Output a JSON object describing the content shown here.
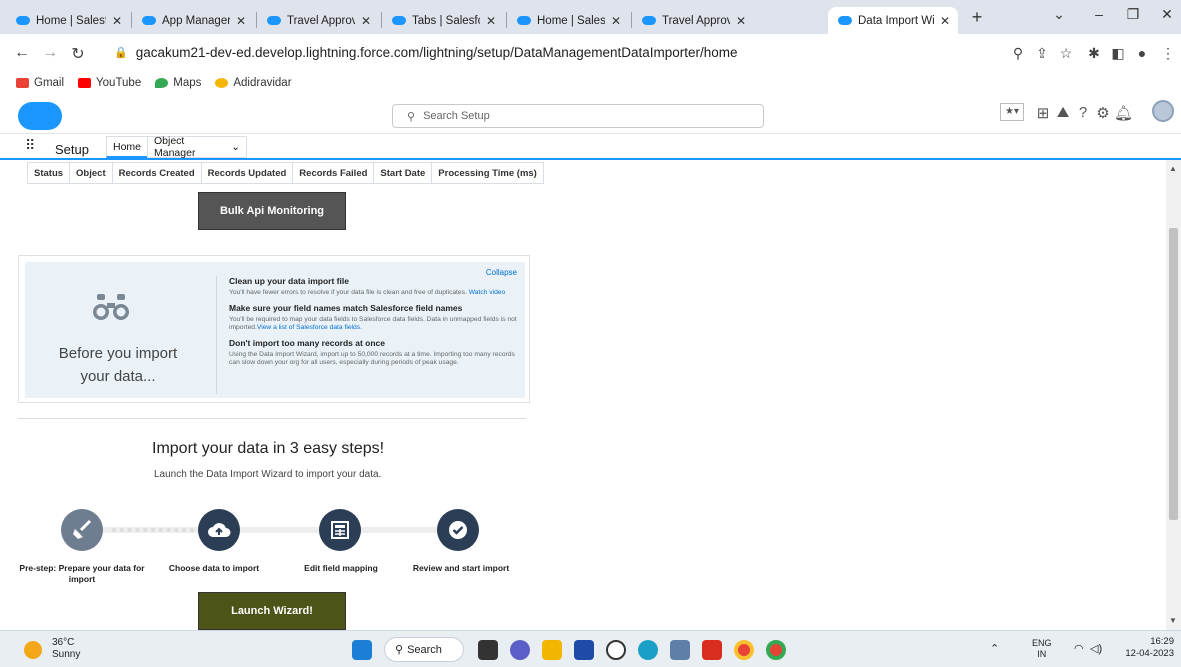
{
  "browser": {
    "tabs": [
      {
        "label": "Home | Salesforce",
        "active": false
      },
      {
        "label": "App Manager | Sa",
        "active": false
      },
      {
        "label": "Travel Approval |",
        "active": false
      },
      {
        "label": "Tabs | Salesforce",
        "active": false
      },
      {
        "label": "Home | Salesforce",
        "active": false
      },
      {
        "label": "Travel Approval |",
        "active": false
      },
      {
        "label": "Data Import Wiza",
        "active": true
      }
    ],
    "url": "gacakum21-dev-ed.develop.lightning.force.com/lightning/setup/DataManagementDataImporter/home",
    "bookmarks": [
      "Gmail",
      "YouTube",
      "Maps",
      "Adidravidar"
    ]
  },
  "sf_header": {
    "search_placeholder": "Search Setup"
  },
  "sf_nav": {
    "app_title": "Setup",
    "tabs": [
      "Home",
      "Object Manager"
    ]
  },
  "status_table": {
    "columns": [
      "Status",
      "Object",
      "Records Created",
      "Records Updated",
      "Records Failed",
      "Start Date",
      "Processing Time (ms)"
    ]
  },
  "bulk_button": "Bulk Api Monitoring",
  "tips_panel": {
    "collapse_label": "Collapse",
    "heading_line1": "Before you import",
    "heading_line2": "your data...",
    "tips": [
      {
        "title": "Clean up your data import file",
        "text": "You'll have fewer errors to resolve if your data file is clean and free of duplicates.",
        "link": "Watch video"
      },
      {
        "title": "Make sure your field names match Salesforce field names",
        "text": "You'll be required to map your data fields to Salesforce data fields. Data in unmapped fields is not imported.",
        "link": "View a list of Salesforce data fields."
      },
      {
        "title": "Don't import too many records at once",
        "text": "Using the Data Import Wizard, import up to 50,000 records at a time. Importing too many records can slow down your org for all users, especially during periods of peak usage.",
        "link": ""
      }
    ]
  },
  "steps": {
    "title": "Import your data in 3 easy steps!",
    "subtitle": "Launch the Data Import Wizard to import your data.",
    "items": [
      {
        "label": "Pre-step: Prepare your data for import",
        "icon": "broom-icon"
      },
      {
        "label": "Choose data to import",
        "icon": "cloud-upload-icon"
      },
      {
        "label": "Edit field mapping",
        "icon": "table-icon"
      },
      {
        "label": "Review and start import",
        "icon": "check-icon"
      }
    ],
    "launch_button": "Launch Wizard!"
  },
  "taskbar": {
    "weather_temp": "36°C",
    "weather_desc": "Sunny",
    "search_label": "Search",
    "lang": "ENG",
    "region": "IN",
    "time": "16:29",
    "date": "12-04-2023"
  },
  "colors": {
    "salesforce_blue": "#1b96ff",
    "step_circle": "#2b3e55",
    "prestep_circle": "#6e7d8f",
    "launch_button": "#4e5317",
    "bulk_button": "#555555"
  }
}
